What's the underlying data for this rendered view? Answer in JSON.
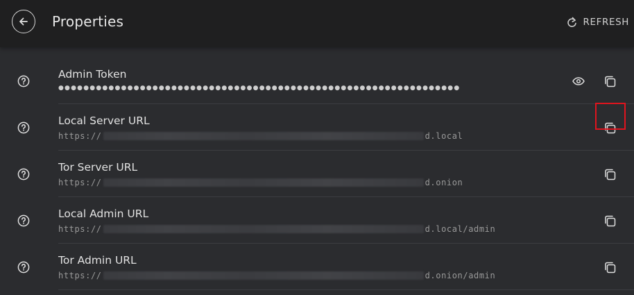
{
  "header": {
    "title": "Properties",
    "refresh_label": "REFRESH"
  },
  "properties": [
    {
      "label": "Admin Token",
      "value_dots": "●●●●●●●●●●●●●●●●●●●●●●●●●●●●●●●●●●●●●●●●●●●●●●●●●●●●●●●●●●●●●●●●",
      "has_eye": true
    },
    {
      "label": "Local Server URL",
      "value_prefix": "https://",
      "value_suffix": "d.local"
    },
    {
      "label": "Tor Server URL",
      "value_prefix": "https://",
      "value_suffix": "d.onion"
    },
    {
      "label": "Local Admin URL",
      "value_prefix": "https://",
      "value_suffix": "d.local/admin"
    },
    {
      "label": "Tor Admin URL",
      "value_prefix": "https://",
      "value_suffix": "d.onion/admin"
    }
  ],
  "colors": {
    "background": "#2b2c2f",
    "header": "#1f1f20",
    "highlight": "#e0141e"
  },
  "icons": {
    "back": "arrow-left-circle-icon",
    "refresh": "refresh-icon",
    "help": "help-circle-icon",
    "eye": "eye-icon",
    "copy": "copy-icon"
  }
}
